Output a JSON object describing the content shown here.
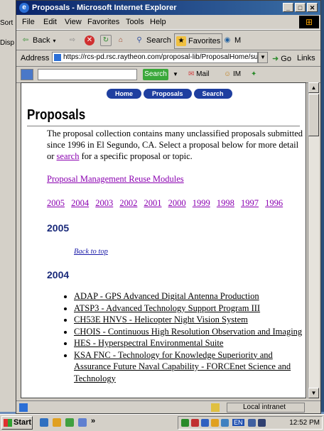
{
  "background_windows": {
    "labels": [
      "Sort",
      "Disp"
    ]
  },
  "window": {
    "title": "Proposals - Microsoft Internet Explorer",
    "menu": [
      "File",
      "Edit",
      "View",
      "Favorites",
      "Tools",
      "Help"
    ],
    "toolbar": {
      "back": "Back",
      "search": "Search",
      "favorites": "Favorites",
      "media": "M"
    },
    "address": {
      "label": "Address",
      "url": "https://rcs-pd.rsc.raytheon.com/proposal-lib/ProposalHome/summ",
      "go": "Go",
      "links": "Links"
    },
    "searchbar": {
      "search_btn": "Search",
      "mail": "Mail",
      "im": "IM"
    },
    "status": {
      "zone": "Local intranet"
    }
  },
  "page": {
    "nav": [
      "Home",
      "Proposals",
      "Search"
    ],
    "title": "Proposals",
    "intro_1": "The proposal collection contains many unclassified proposals submitted since 1996 in El Segundo, CA. Select a proposal below for more detail or",
    "intro_link": "search",
    "intro_2": "for a specific proposal or topic.",
    "reuse_link": "Proposal Management Reuse Modules",
    "years": [
      "2005",
      "2004",
      "2003",
      "2002",
      "2001",
      "2000",
      "1999",
      "1998",
      "1997",
      "1996"
    ],
    "section_2005": "2005",
    "back_to_top": "Back to top",
    "section_2004": "2004",
    "proposals_2004": [
      "ADAP - GPS Advanced Digital Antenna Production",
      "ATSP3 - Advanced Technology Support Program III",
      "CH53E HNVS - Helicopter Night Vision System",
      "CHOIS - Continuous High Resolution Observation and Imaging",
      "HES - Hyperspectral Environmental Suite",
      "KSA FNC - Technology for Knowledge Superiority and Assurance Future Naval Capability - FORCEnet Science and Technology"
    ]
  },
  "taskbar": {
    "start": "Start",
    "clock": "12:52 PM",
    "tray_lang": "EN"
  }
}
